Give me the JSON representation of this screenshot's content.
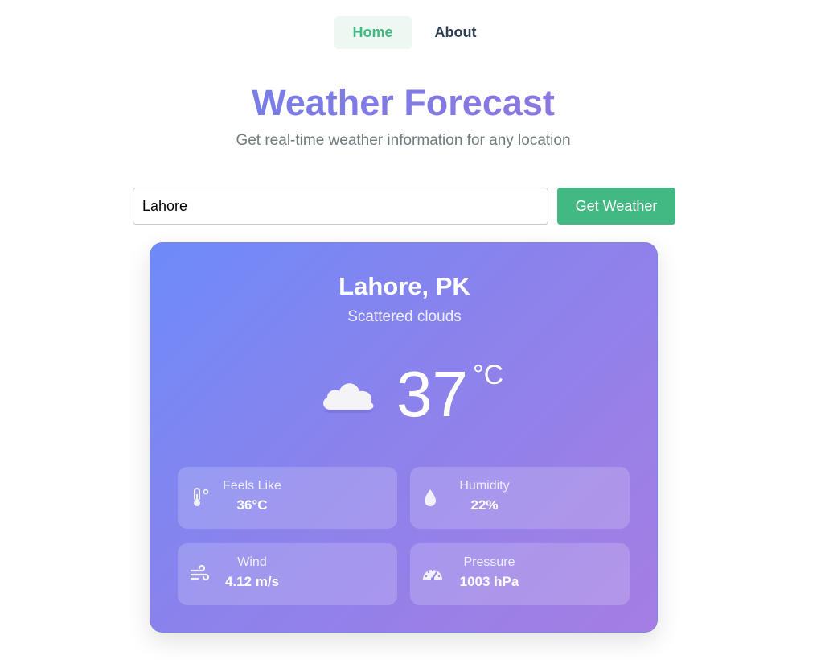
{
  "nav": {
    "items": [
      {
        "label": "Home",
        "active": true
      },
      {
        "label": "About",
        "active": false
      }
    ]
  },
  "header": {
    "title": "Weather Forecast",
    "subtitle": "Get real-time weather information for any location"
  },
  "search": {
    "value": "Lahore",
    "button_label": "Get Weather"
  },
  "weather": {
    "location": "Lahore, PK",
    "description": "Scattered clouds",
    "icon": "cloud-icon",
    "temperature": "37",
    "unit": "°C",
    "stats": [
      {
        "label": "Feels Like",
        "value": "36°C",
        "icon": "thermometer-icon"
      },
      {
        "label": "Humidity",
        "value": "22%",
        "icon": "droplet-icon"
      },
      {
        "label": "Wind",
        "value": "4.12 m/s",
        "icon": "wind-icon"
      },
      {
        "label": "Pressure",
        "value": "1003 hPa",
        "icon": "gauge-icon"
      }
    ]
  },
  "colors": {
    "accent": "#42b983",
    "gradient_start": "#6d8bf9",
    "gradient_end": "#a57ee3"
  }
}
